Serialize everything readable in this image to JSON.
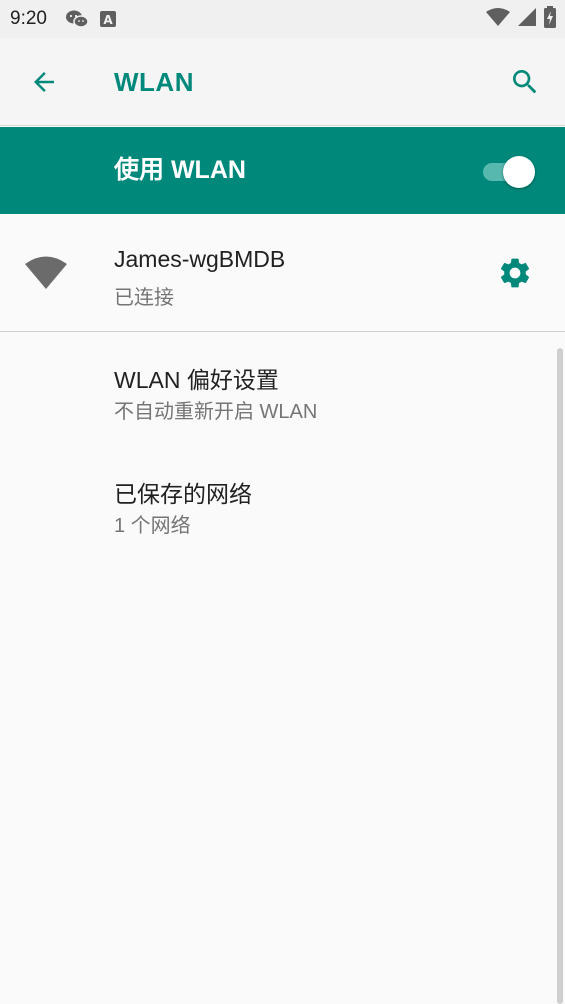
{
  "status_bar": {
    "time": "9:20",
    "icons": [
      "wechat-icon",
      "a-notification-icon",
      "wifi-signal-icon",
      "cell-signal-icon",
      "battery-icon"
    ]
  },
  "app_bar": {
    "title": "WLAN",
    "back_icon": "arrow-back-icon",
    "search_icon": "search-icon",
    "accent_color": "#00897b"
  },
  "master_switch": {
    "label": "使用 WLAN",
    "enabled": true,
    "background_color": "#00897b"
  },
  "connected_network": {
    "name": "James-wgBMDB",
    "status": "已连接",
    "icon": "wifi-icon",
    "settings_icon": "gear-icon"
  },
  "preferences": [
    {
      "title": "WLAN 偏好设置",
      "summary": "不自动重新开启 WLAN"
    },
    {
      "title": "已保存的网络",
      "summary": "1 个网络"
    }
  ]
}
